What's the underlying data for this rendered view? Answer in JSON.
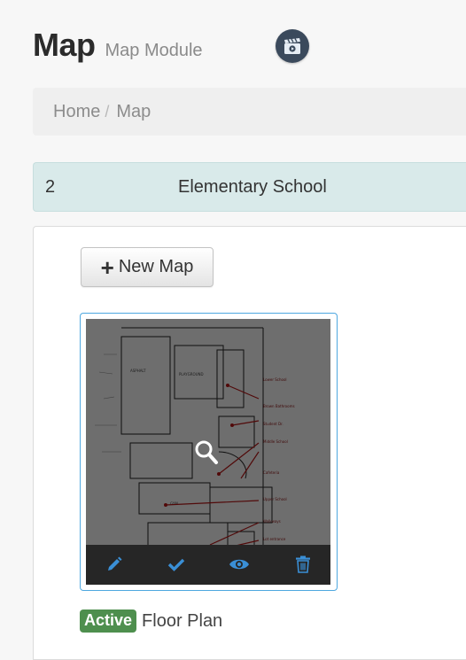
{
  "header": {
    "title": "Map",
    "subtitle": "Map Module",
    "video_icon": "video-clapper-icon"
  },
  "breadcrumb": {
    "items": [
      "Home",
      "Map"
    ],
    "separator": "/"
  },
  "info_bar": {
    "number": "2",
    "name": "Elementary School"
  },
  "toolbar": {
    "new_map_label": "New Map"
  },
  "map_card": {
    "status_badge": "Active",
    "name": "Floor Plan",
    "actions": [
      "pencil-icon",
      "check-icon",
      "eye-icon",
      "trash-icon"
    ],
    "action_color": "#3a8fd6"
  },
  "colors": {
    "badge": "#4e8f4e",
    "card_border": "#4ea8e0",
    "info_bar": "#d9eaea"
  }
}
